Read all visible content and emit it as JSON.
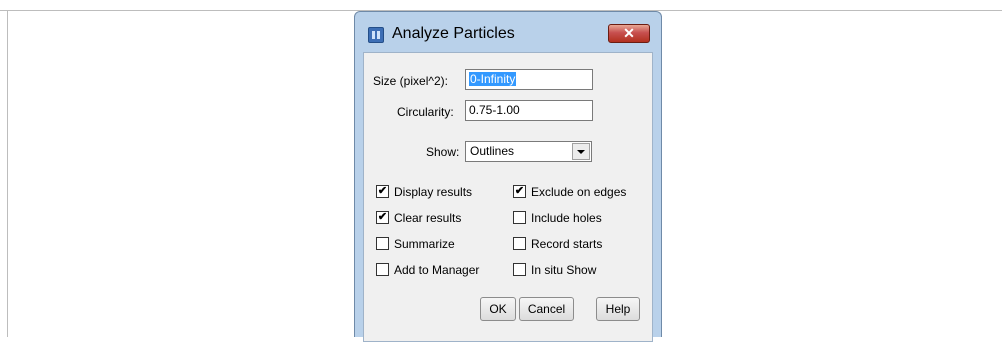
{
  "dialog": {
    "title": "Analyze Particles",
    "close_symbol": "✕",
    "size_label": "Size (pixel^2):",
    "size_value": "0-Infinity",
    "circularity_label": "Circularity:",
    "circularity_value": "0.75-1.00",
    "show_label": "Show:",
    "show_value": "Outlines",
    "checkboxes_left": [
      {
        "label": "Display results",
        "checked": true
      },
      {
        "label": "Clear results",
        "checked": true
      },
      {
        "label": "Summarize",
        "checked": false
      },
      {
        "label": "Add to Manager",
        "checked": false
      }
    ],
    "checkboxes_right": [
      {
        "label": "Exclude on edges",
        "checked": true
      },
      {
        "label": "Include holes",
        "checked": false
      },
      {
        "label": "Record starts",
        "checked": false
      },
      {
        "label": "In situ Show",
        "checked": false
      }
    ],
    "buttons": {
      "ok": "OK",
      "cancel": "Cancel",
      "help": "Help"
    }
  },
  "icons": {
    "app": "imagej-icon",
    "close": "close-icon",
    "dropdown": "chevron-down-icon"
  },
  "colors": {
    "titlebar": "#b9d1ea",
    "close": "#c75050",
    "selection": "#3399ff"
  }
}
